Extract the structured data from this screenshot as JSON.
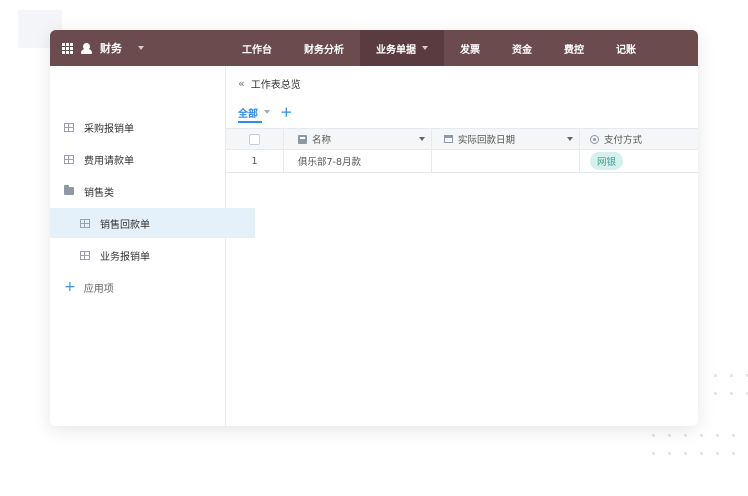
{
  "app": {
    "name": "财务"
  },
  "nav": {
    "items": [
      {
        "label": "工作台"
      },
      {
        "label": "财务分析"
      },
      {
        "label": "业务单据"
      },
      {
        "label": "发票"
      },
      {
        "label": "资金"
      },
      {
        "label": "费控"
      },
      {
        "label": "记账"
      }
    ]
  },
  "sidebar": {
    "items": [
      {
        "label": "采购报销单"
      },
      {
        "label": "费用请款单"
      },
      {
        "label": "销售类"
      },
      {
        "label": "销售回款单"
      },
      {
        "label": "业务报销单"
      }
    ],
    "add_label": "应用项"
  },
  "main": {
    "breadcrumb": "工作表总览",
    "tabs": {
      "all_label": "全部"
    }
  },
  "table": {
    "columns": [
      {
        "label": "名称"
      },
      {
        "label": "实际回款日期"
      },
      {
        "label": "支付方式"
      }
    ],
    "rows": [
      {
        "index": "1",
        "name": "俱乐部7-8月款",
        "date": "",
        "payment": "网银"
      }
    ]
  },
  "colors": {
    "topbar": "#6c4b4f",
    "accent": "#2d8cf0",
    "tag_bg": "#d4f1ee"
  }
}
